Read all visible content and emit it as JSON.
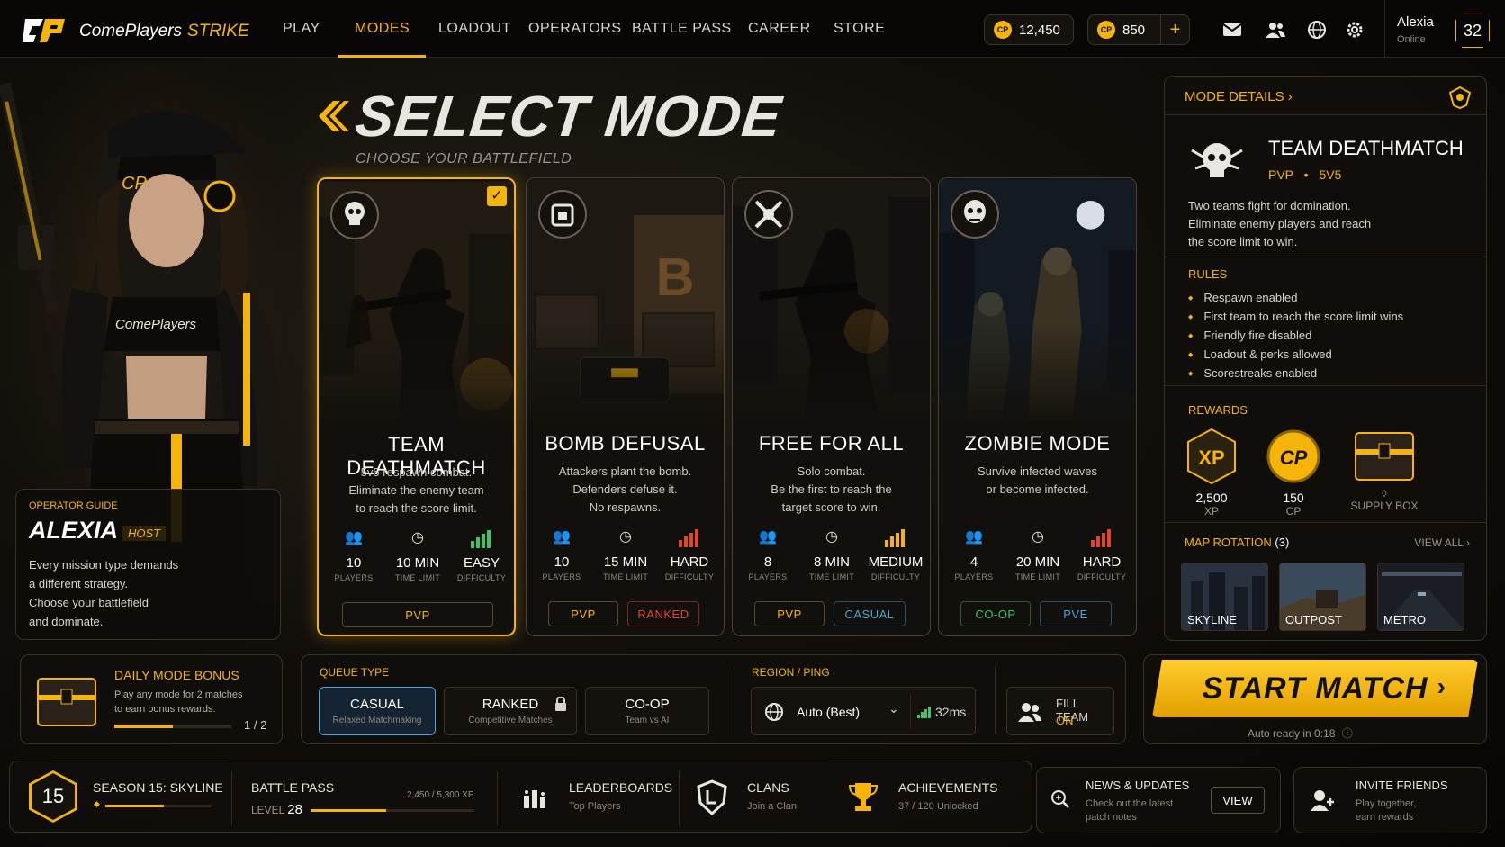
{
  "brand": {
    "name": "ComePlayers",
    "suffix": "STRIKE"
  },
  "nav": [
    {
      "label": "PLAY"
    },
    {
      "label": "MODES",
      "active": true
    },
    {
      "label": "LOADOUT"
    },
    {
      "label": "OPERATORS"
    },
    {
      "label": "BATTLE PASS"
    },
    {
      "label": "CAREER"
    },
    {
      "label": "STORE"
    }
  ],
  "currency": {
    "cp_coins": "12,450",
    "premium": "850",
    "coin_glyph": "CP"
  },
  "user": {
    "name": "Alexia",
    "status": "Online",
    "level": "32"
  },
  "header": {
    "title": "SELECT MODE",
    "subtitle": "CHOOSE YOUR BATTLEFIELD"
  },
  "operator": {
    "guide_label": "OPERATOR GUIDE",
    "name": "ALEXIA",
    "role": "HOST",
    "lines": [
      "Every mission type demands",
      "a different strategy.",
      "Choose your battlefield",
      "and dominate."
    ]
  },
  "modes": [
    {
      "title": "TEAM DEATHMATCH",
      "desc": [
        "5v5 respawn combat.",
        "Eliminate the enemy team",
        "to reach the score limit."
      ],
      "players": "10",
      "time": "10 MIN",
      "difficulty": "EASY",
      "tags": [
        "PVP"
      ],
      "selected": true
    },
    {
      "title": "BOMB DEFUSAL",
      "desc": [
        "Attackers plant the bomb.",
        "Defenders defuse it.",
        "No respawns."
      ],
      "players": "10",
      "time": "15 MIN",
      "difficulty": "HARD",
      "tags": [
        "PVP",
        "RANKED"
      ],
      "art_letter": "B"
    },
    {
      "title": "FREE FOR ALL",
      "desc": [
        "Solo combat.",
        "Be the first to reach the",
        "target score to win."
      ],
      "players": "8",
      "time": "8 MIN",
      "difficulty": "MEDIUM",
      "tags": [
        "PVP",
        "CASUAL"
      ]
    },
    {
      "title": "ZOMBIE MODE",
      "desc": [
        "Survive infected waves",
        "or become infected."
      ],
      "players": "4",
      "time": "20 MIN",
      "difficulty": "HARD",
      "tags": [
        "CO-OP",
        "PVE"
      ]
    }
  ],
  "stat_labels": {
    "players": "PLAYERS",
    "time": "TIME LIMIT",
    "difficulty": "DIFFICULTY"
  },
  "details": {
    "header": "MODE DETAILS",
    "mode_title": "TEAM DEATHMATCH",
    "meta_a": "PVP",
    "meta_b": "5V5",
    "desc": [
      "Two teams fight for domination.",
      "Eliminate enemy players and reach",
      "the score limit to win."
    ],
    "rules_label": "RULES",
    "rules": [
      "Respawn enabled",
      "First team to reach the score limit wins",
      "Friendly fire disabled",
      "Loadout & perks allowed",
      "Scorestreaks enabled"
    ],
    "rewards_label": "REWARDS",
    "rewards": [
      {
        "icon_text": "XP",
        "value": "2,500",
        "unit": "XP"
      },
      {
        "icon_text": "CP",
        "value": "150",
        "unit": "CP"
      },
      {
        "icon_text": "",
        "value": "◊",
        "unit": "SUPPLY BOX"
      }
    ],
    "map_label": "MAP ROTATION",
    "map_count": "(3)",
    "view_all": "VIEW ALL",
    "maps": [
      "SKYLINE",
      "OUTPOST",
      "METRO"
    ]
  },
  "daily": {
    "title": "DAILY MODE BONUS",
    "desc": [
      "Play any mode for 2 matches",
      "to earn bonus rewards."
    ],
    "progress_text": "1 / 2",
    "progress": 0.5
  },
  "queue": {
    "label": "QUEUE TYPE",
    "options": [
      {
        "title": "CASUAL",
        "sub": "Relaxed Matchmaking",
        "selected": true
      },
      {
        "title": "RANKED",
        "sub": "Competitive Matches",
        "locked": true
      },
      {
        "title": "CO-OP",
        "sub": "Team vs AI"
      }
    ]
  },
  "region": {
    "label": "REGION / PING",
    "value": "Auto (Best)",
    "ping": "32ms"
  },
  "fill_team": {
    "label": "FILL TEAM",
    "state": "ON"
  },
  "start": {
    "label": "START MATCH",
    "auto_ready": "Auto ready in 0:18"
  },
  "season": {
    "level": "15",
    "name": "SEASON 15: SKYLINE",
    "progress": 0.55
  },
  "battle_pass": {
    "label": "BATTLE PASS",
    "level_label": "LEVEL",
    "level": "28",
    "xp": "2,450 / 5,300 XP",
    "progress": 0.46
  },
  "links": [
    {
      "title": "LEADERBOARDS",
      "sub": "Top Players"
    },
    {
      "title": "CLANS",
      "sub": "Join a Clan"
    },
    {
      "title": "ACHIEVEMENTS",
      "sub": "37 / 120 Unlocked"
    }
  ],
  "news": {
    "title": "NEWS & UPDATES",
    "sub": [
      "Check out the latest",
      "patch notes"
    ],
    "button": "VIEW"
  },
  "invite": {
    "title": "INVITE FRIENDS",
    "sub": [
      "Play together,",
      "earn rewards"
    ]
  },
  "colors": {
    "accent": "#f5b40a",
    "ranked": "#e0452e",
    "casual": "#4fa3d9",
    "coop": "#3ec46d",
    "pve": "#4fa3d9"
  }
}
